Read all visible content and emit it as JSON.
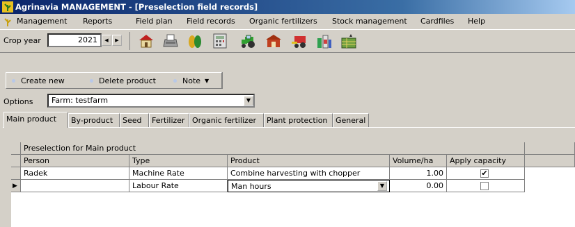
{
  "window": {
    "title": "Agrinavia MANAGEMENT - [Preselection field records]"
  },
  "menu": [
    "Management",
    "Reports",
    "Field plan",
    "Field records",
    "Organic fertilizers",
    "Stock management",
    "Cardfiles",
    "Help"
  ],
  "toolbar": {
    "crop_year_label": "Crop year",
    "crop_year_value": "2021",
    "icons": [
      "home-icon",
      "printer-icon",
      "seed-icon",
      "calculator-icon",
      "tractor-icon",
      "barn-icon",
      "harvester-icon",
      "bottles-icon",
      "field-icon"
    ]
  },
  "actions": {
    "create_new": "Create new",
    "delete_product": "Delete product",
    "note": "Note"
  },
  "options": {
    "label": "Options",
    "selected": "Farm: testfarm"
  },
  "tabs": [
    "Main product",
    "By-product",
    "Seed",
    "Fertilizer",
    "Organic fertilizer",
    "Plant protection",
    "General"
  ],
  "grid": {
    "group_header": "Preselection for Main product",
    "columns": [
      "Person",
      "Type",
      "Product",
      "Volume/ha",
      "Apply capacity"
    ],
    "rows": [
      {
        "person": "Radek",
        "type": "Machine Rate",
        "product": "Combine harvesting with chopper",
        "volume": "1.00",
        "apply": true
      },
      {
        "person": "",
        "type": "Labour Rate",
        "product": "Man hours",
        "volume": "0.00",
        "apply": false
      }
    ]
  },
  "colors": {
    "titlebar": "#0a246a",
    "face": "#d4d0c8"
  }
}
